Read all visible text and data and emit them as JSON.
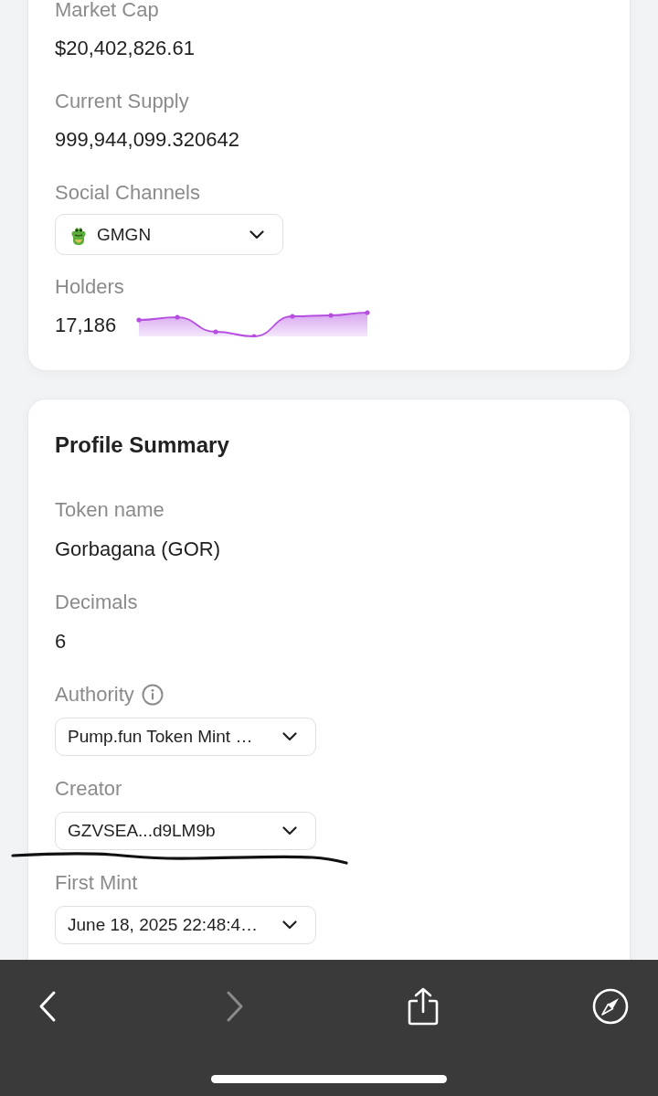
{
  "info_card": {
    "fields": [
      {
        "kind": "text",
        "label": "Market Cap",
        "value": "$20,402,826.61"
      },
      {
        "kind": "text",
        "label": "Current Supply",
        "value": "999,944,099.320642"
      },
      {
        "kind": "dropdown",
        "label": "Social Channels",
        "value": "GMGN",
        "leading_icon": true
      },
      {
        "kind": "trend",
        "label": "Holders",
        "value": "17,186"
      }
    ]
  },
  "profile_summary": {
    "title": "Profile Summary",
    "fields": [
      {
        "kind": "text",
        "label": "Token name",
        "value": "Gorbagana (GOR)"
      },
      {
        "kind": "text",
        "label": "Decimals",
        "value": "6"
      },
      {
        "kind": "dropdown",
        "label": "Authority",
        "value": "Pump.fun Token Mint …",
        "info": true
      },
      {
        "kind": "dropdown",
        "label": "Creator",
        "value": "GZVSEA...d9LM9b"
      },
      {
        "kind": "dropdown",
        "label": "First Mint",
        "value": "June 18, 2025 22:48:4…"
      }
    ]
  },
  "browser_toolbar": {
    "buttons": [
      {
        "kind": "back",
        "disabled": false
      },
      {
        "kind": "forward",
        "disabled": true
      },
      {
        "kind": "share",
        "disabled": false
      },
      {
        "kind": "compass",
        "disabled": false
      }
    ]
  }
}
